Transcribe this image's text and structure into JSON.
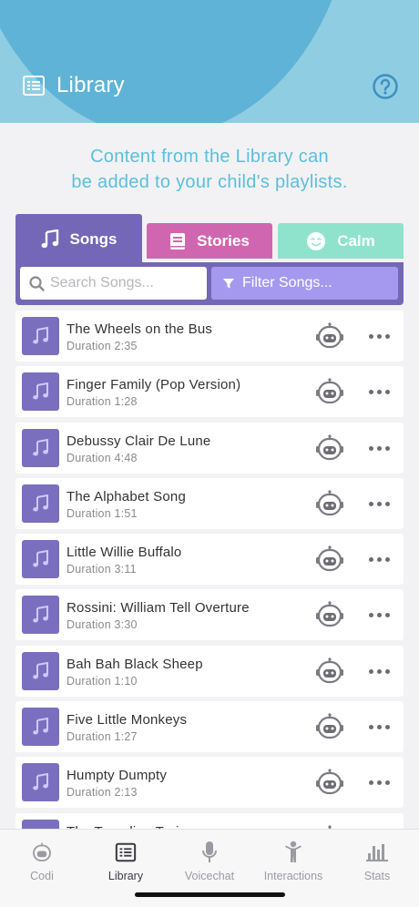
{
  "header": {
    "title": "Library",
    "help_icon": "question-circle-icon",
    "list_icon": "list-icon"
  },
  "intro": {
    "line1": "Content from the Library can",
    "line2": "be added to your child's playlists."
  },
  "tabs": [
    {
      "label": "Songs",
      "icon": "music-note-icon",
      "color": "#7467b8",
      "selected": true
    },
    {
      "label": "Stories",
      "icon": "book-icon",
      "color": "#d166b0",
      "selected": false
    },
    {
      "label": "Calm",
      "icon": "smile-icon",
      "color": "#8fe3cc",
      "selected": false
    }
  ],
  "search": {
    "placeholder": "Search Songs...",
    "value": "",
    "filter_label": "Filter Songs..."
  },
  "songs": [
    {
      "title": "The Wheels on the Bus",
      "duration": "Duration 2:35"
    },
    {
      "title": "Finger Family (Pop Version)",
      "duration": "Duration 1:28"
    },
    {
      "title": "Debussy Clair De Lune",
      "duration": "Duration 4:48"
    },
    {
      "title": "The Alphabet Song",
      "duration": "Duration 1:51"
    },
    {
      "title": "Little Willie Buffalo",
      "duration": "Duration 3:11"
    },
    {
      "title": "Rossini: William Tell Overture",
      "duration": "Duration 3:30"
    },
    {
      "title": "Bah Bah Black Sheep",
      "duration": "Duration 1:10"
    },
    {
      "title": "Five Little Monkeys",
      "duration": "Duration 1:27"
    },
    {
      "title": "Humpty Dumpty",
      "duration": "Duration 2:13"
    },
    {
      "title": "The Traveling Train",
      "duration": ""
    }
  ],
  "nav": [
    {
      "label": "Codi",
      "icon": "robot-icon",
      "active": false
    },
    {
      "label": "Library",
      "icon": "list-icon",
      "active": true
    },
    {
      "label": "Voicechat",
      "icon": "microphone-icon",
      "active": false
    },
    {
      "label": "Interactions",
      "icon": "person-icon",
      "active": false
    },
    {
      "label": "Stats",
      "icon": "bar-chart-icon",
      "active": false
    }
  ],
  "colors": {
    "header_light": "#8fcde3",
    "header_dark": "#5fb3d6",
    "accent": "#7467b8",
    "intro_text": "#5bbfdc"
  }
}
